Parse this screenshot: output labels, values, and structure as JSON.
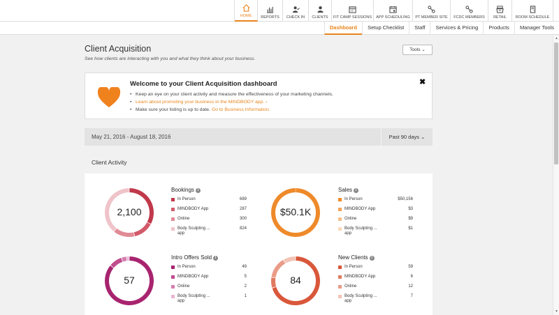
{
  "nav": {
    "items": [
      {
        "label": "HOME",
        "icon": "home-icon",
        "active": true,
        "w": 33
      },
      {
        "label": "REPORTS",
        "icon": "bar-chart-icon",
        "w": 36
      },
      {
        "label": "CHECK IN",
        "icon": "person-check-icon",
        "w": 37
      },
      {
        "label": "CLIENTS",
        "icon": "person-icon",
        "w": 33
      },
      {
        "label": "FIT CAMP SESSIONS",
        "icon": "calendar-grid-icon",
        "w": 60
      },
      {
        "label": "APP SCHEDULING",
        "icon": "calendar-icon",
        "w": 56
      },
      {
        "label": "PT MEMBER SITE",
        "icon": "link-icon",
        "w": 54
      },
      {
        "label": "FCDC MEMBERS",
        "icon": "link-icon",
        "w": 54
      },
      {
        "label": "RETAIL",
        "icon": "register-icon",
        "w": 34
      },
      {
        "label": "ROOM SCHEDULE",
        "icon": "door-icon",
        "w": 59
      }
    ]
  },
  "subnav": {
    "tabs": [
      {
        "label": "Dashboard",
        "active": true
      },
      {
        "label": "Setup Checklist"
      },
      {
        "label": "Staff"
      },
      {
        "label": "Services & Pricing"
      },
      {
        "label": "Products"
      },
      {
        "label": "Manager Tools"
      }
    ]
  },
  "page": {
    "title": "Client Acquisition",
    "subtitle": "See how clients are interacting with you and what they think about your business.",
    "tools_label": "Tools"
  },
  "welcome": {
    "title": "Welcome to your Client Acquisition dashboard",
    "bullet1": "Keep an eye on your client activity and measure the effectiveness of your marketing channels.",
    "bullet2_link": "Learn about promoting your business in the MINDBODY app.",
    "bullet3_text": "Make sure your listing is up to date.",
    "bullet3_link": "Go to Business Information.",
    "heart_color": "#f0821e"
  },
  "date_range": {
    "label": "May 21, 2016 - August 18, 2016",
    "period": "Past 90 days"
  },
  "activity": {
    "title": "Client Activity",
    "metrics": [
      {
        "key": "bookings",
        "title": "Bookings",
        "center": "2,100",
        "rows": [
          {
            "label": "In Person",
            "value": "689",
            "num": 689,
            "color": "#c0394b"
          },
          {
            "label": "MINDBODY App",
            "value": "287",
            "num": 287,
            "color": "#d35a6a"
          },
          {
            "label": "Online",
            "value": "300",
            "num": 300,
            "color": "#e08a96"
          },
          {
            "label": "Body Sculpting ...",
            "label2": "app",
            "value": "824",
            "num": 824,
            "color": "#efc3c9"
          }
        ]
      },
      {
        "key": "sales",
        "title": "Sales",
        "center": "$50.1K",
        "rows": [
          {
            "label": "In Person",
            "value": "$50,156",
            "num": 50156,
            "color": "#ee8a2a"
          },
          {
            "label": "MINDBODY App",
            "value": "$3",
            "num": 3,
            "color": "#f2a55a"
          },
          {
            "label": "Online",
            "value": "$9",
            "num": 9,
            "color": "#f5bf88"
          },
          {
            "label": "Body Sculpting ...",
            "label2": "app",
            "value": "$1",
            "num": 1,
            "color": "#f9d9b9"
          }
        ]
      },
      {
        "key": "intro",
        "title": "Intro Offers Sold",
        "center": "57",
        "rows": [
          {
            "label": "In Person",
            "value": "49",
            "num": 49,
            "color": "#a8246f"
          },
          {
            "label": "MINDBODY App",
            "value": "5",
            "num": 5,
            "color": "#c04d8c"
          },
          {
            "label": "Online",
            "value": "2",
            "num": 2,
            "color": "#d57fb0"
          },
          {
            "label": "Body Sculpting ...",
            "label2": "app",
            "value": "1",
            "num": 1,
            "color": "#e8b6d2"
          }
        ]
      },
      {
        "key": "newclients",
        "title": "New Clients",
        "center": "84",
        "rows": [
          {
            "label": "In Person",
            "value": "59",
            "num": 59,
            "color": "#d9573a"
          },
          {
            "label": "MINDBODY App",
            "value": "6",
            "num": 6,
            "color": "#e07a60"
          },
          {
            "label": "Online",
            "value": "12",
            "num": 12,
            "color": "#e99c88"
          },
          {
            "label": "Body Sculpting ...",
            "label2": "app",
            "value": "7",
            "num": 7,
            "color": "#f2c4b6"
          }
        ]
      }
    ]
  }
}
